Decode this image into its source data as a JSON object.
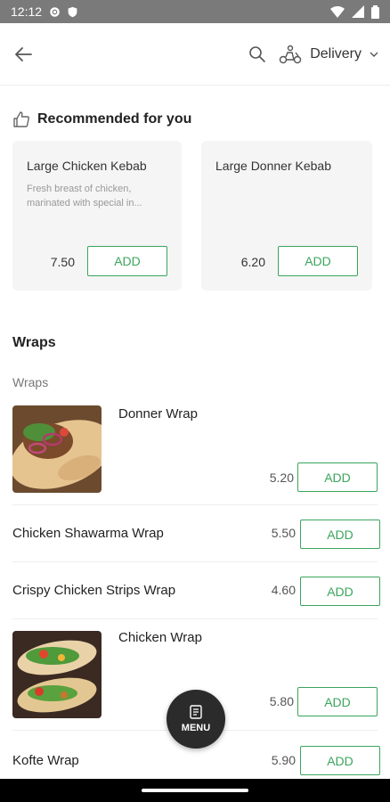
{
  "status_bar": {
    "time": "12:12"
  },
  "header": {
    "delivery_label": "Delivery"
  },
  "recommended": {
    "title": "Recommended for you",
    "items": [
      {
        "name": "Large Chicken Kebab",
        "description": "Fresh breast of chicken, marinated with special in...",
        "price": "7.50",
        "add_label": "ADD"
      },
      {
        "name": "Large Donner Kebab",
        "description": "",
        "price": "6.20",
        "add_label": "ADD"
      }
    ]
  },
  "section": {
    "title": "Wraps",
    "subtitle": "Wraps"
  },
  "items": [
    {
      "name": "Donner Wrap",
      "price": "5.20",
      "add_label": "ADD",
      "image": "donner-wrap-photo"
    },
    {
      "name": "Chicken Shawarma Wrap",
      "price": "5.50",
      "add_label": "ADD"
    },
    {
      "name": "Crispy Chicken Strips Wrap",
      "price": "4.60",
      "add_label": "ADD"
    },
    {
      "name": "Chicken Wrap",
      "price": "5.80",
      "add_label": "ADD",
      "image": "chicken-wrap-photo"
    },
    {
      "name": "Kofte Wrap",
      "price": "5.90",
      "add_label": "ADD"
    }
  ],
  "menu_button": {
    "label": "MENU"
  },
  "colors": {
    "accent": "#3ba55c",
    "fab": "#2b2b2b",
    "statusbar": "#7a7a7a"
  }
}
